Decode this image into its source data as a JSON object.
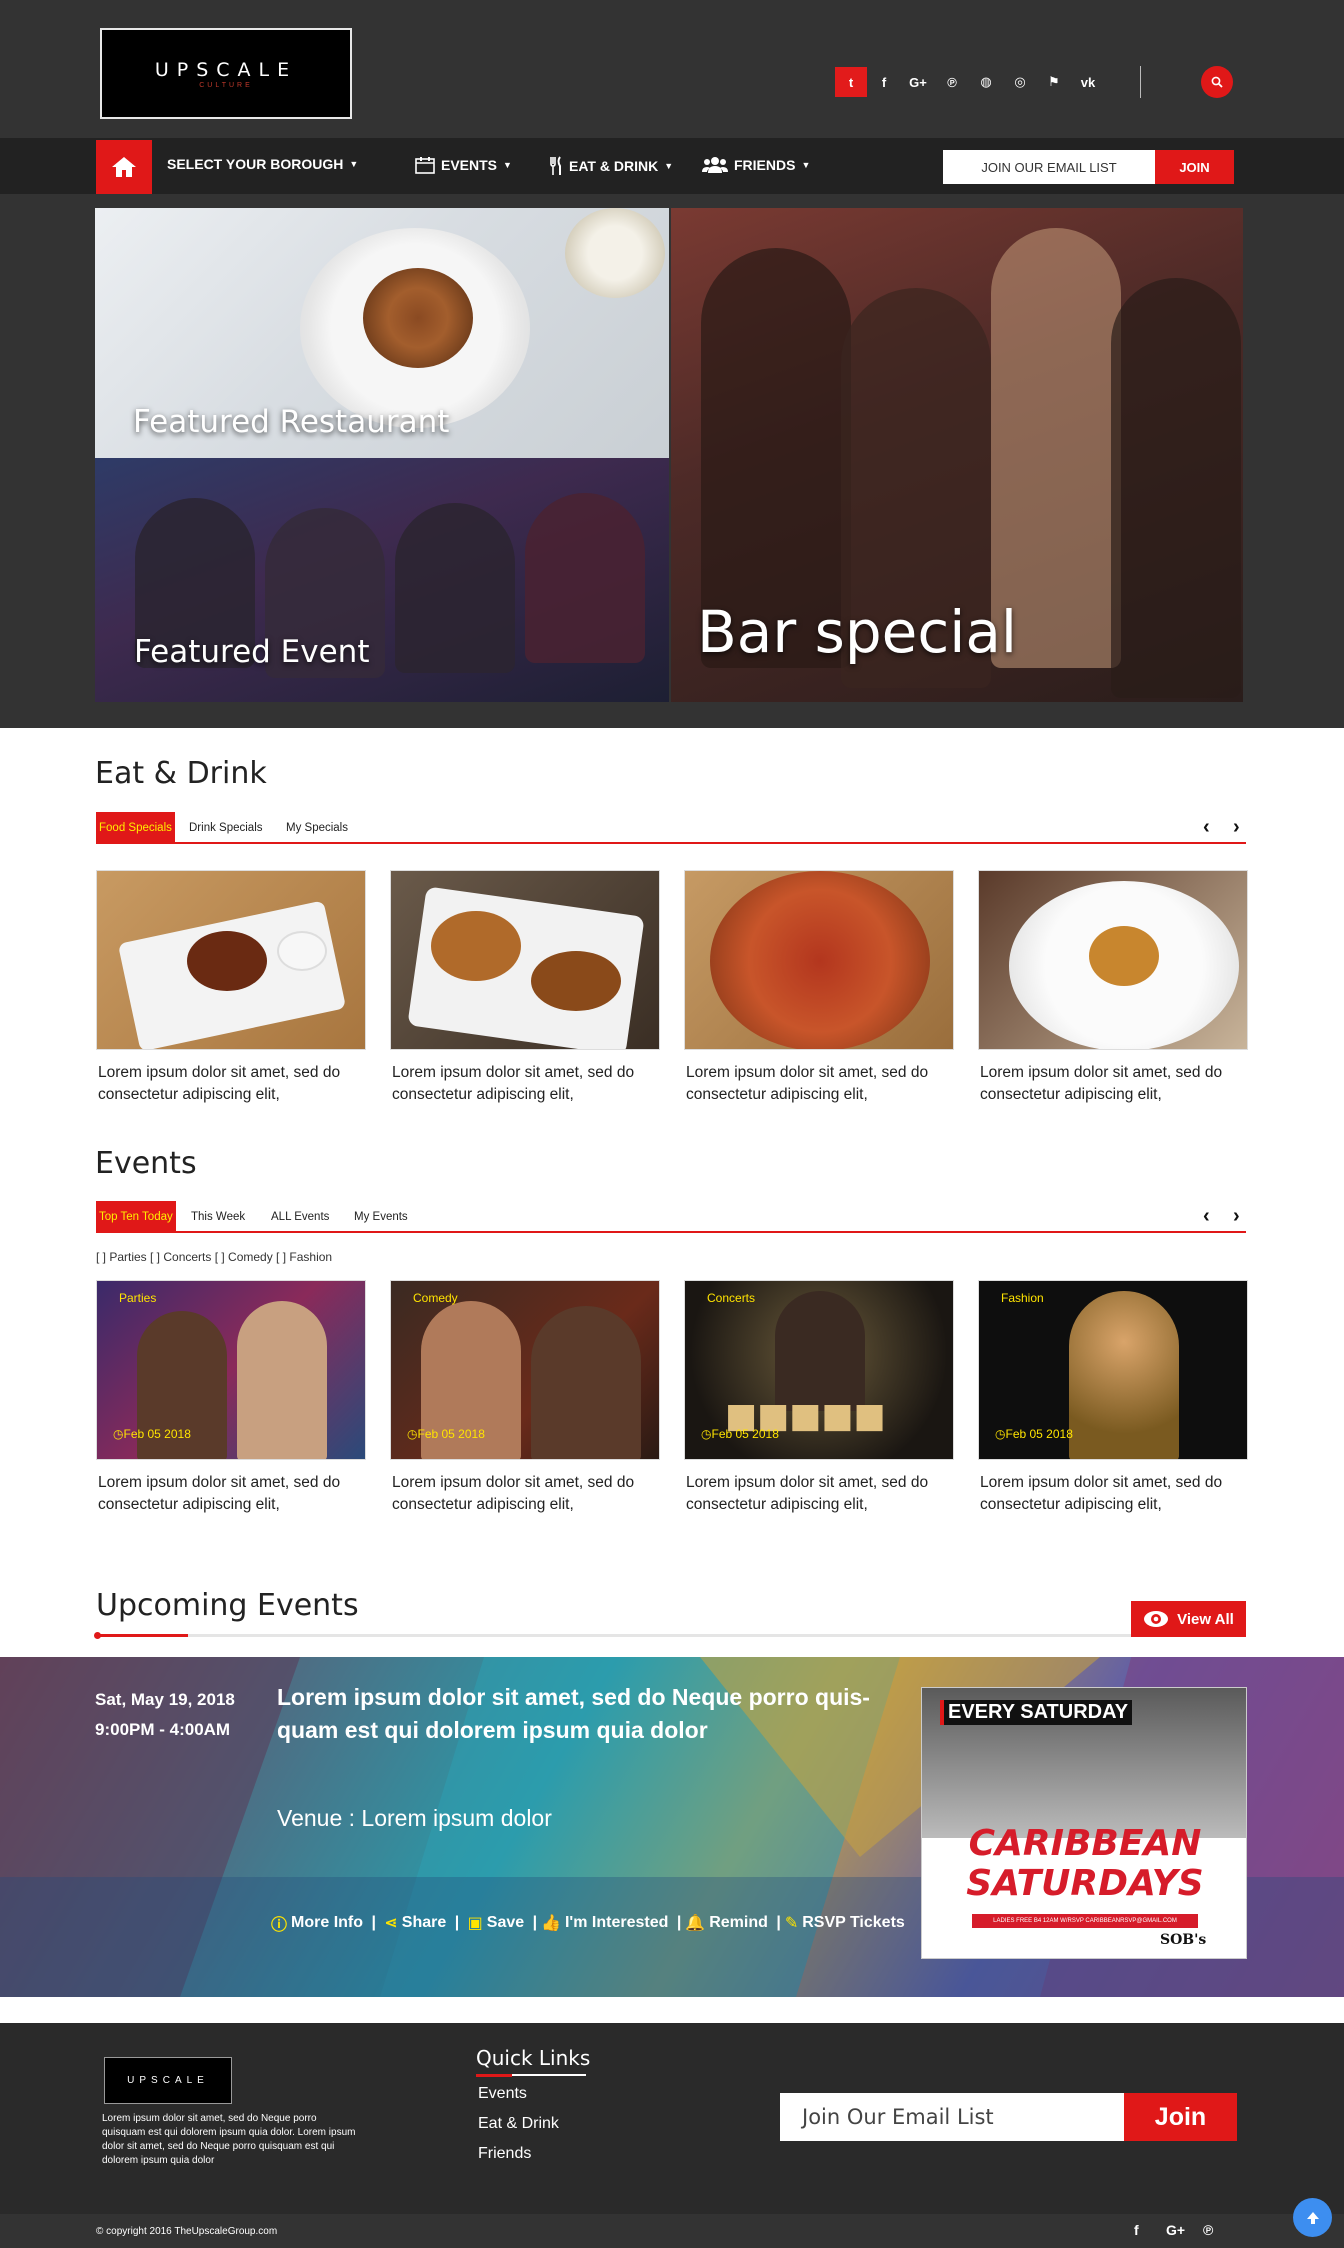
{
  "brand": {
    "logo_text": "UPSCALE",
    "logo_sub": "CULTURE",
    "footer_logo_text": "UPSCALE"
  },
  "header": {
    "social_icons": [
      "twitter-icon",
      "facebook-icon",
      "google-plus-icon",
      "pinterest-icon",
      "github-icon",
      "dribbble-icon",
      "foursquare-icon",
      "vk-icon"
    ],
    "social_glyphs": [
      "t",
      "f",
      "G+",
      "℗",
      "◍",
      "◎",
      "⚑",
      "vk"
    ],
    "search_icon": "search-icon"
  },
  "nav": {
    "borough_label": "SELECT YOUR BOROUGH",
    "events_label": "EVENTS",
    "eat_drink_label": "EAT & DRINK",
    "friends_label": "FRIENDS",
    "email_label": "JOIN OUR EMAIL LIST",
    "join_label": "JOIN"
  },
  "hero": {
    "featured_restaurant": "Featured Restaurant",
    "featured_event": "Featured Event",
    "bar_special": "Bar special"
  },
  "eat_drink": {
    "title": "Eat & Drink",
    "tabs": [
      "Food Specials",
      "Drink Specials",
      "My Specials"
    ],
    "cards": [
      {
        "text": "Lorem ipsum dolor sit amet, sed do consectetur adipiscing elit,"
      },
      {
        "text": "Lorem ipsum dolor sit amet, sed do consectetur adipiscing elit,"
      },
      {
        "text": "Lorem ipsum dolor sit amet, sed do consectetur adipiscing elit,"
      },
      {
        "text": "Lorem ipsum dolor sit amet, sed do consectetur adipiscing elit,"
      }
    ]
  },
  "events": {
    "title": "Events",
    "tabs": [
      "Top Ten Today",
      "This Week",
      "ALL Events",
      "My Events"
    ],
    "filters": "[ ] Parties   [ ] Concerts  [ ] Comedy  [ ] Fashion",
    "cards": [
      {
        "category": "Parties",
        "date": "Feb 05 2018",
        "text": "Lorem ipsum dolor sit amet, sed do consectetur adipiscing elit,"
      },
      {
        "category": "Comedy",
        "date": "Feb 05 2018",
        "text": "Lorem ipsum dolor sit amet, sed do consectetur adipiscing elit,"
      },
      {
        "category": "Concerts",
        "date": "Feb 05 2018",
        "text": "Lorem ipsum dolor sit amet, sed do consectetur adipiscing elit,"
      },
      {
        "category": "Fashion",
        "date": "Feb 05 2018",
        "text": "Lorem ipsum dolor sit amet, sed do consectetur adipiscing elit,"
      }
    ]
  },
  "upcoming": {
    "title": "Upcoming Events",
    "view_all": "View All",
    "date": "Sat, May 19, 2018",
    "time": "9:00PM - 4:00AM",
    "headline": "Lorem ipsum dolor sit amet, sed do Neque porro quis-quam est qui dolorem ipsum quia dolor",
    "venue": "Venue : Lorem ipsum dolor",
    "actions": [
      "More Info",
      "Share",
      "Save",
      "I'm Interested",
      "Remind",
      "RSVP Tickets"
    ],
    "flyer_top": "EVERY SATURDAY",
    "flyer_title_1": "CARIBBEAN",
    "flyer_title_2": "SATURDAYS",
    "flyer_strip": "LADIES FREE B4 12AM W/RSVP CARIBBEANRSVP@GMAIL.COM",
    "flyer_brand": "SOB's"
  },
  "footer": {
    "description": "Lorem ipsum dolor sit amet, sed do Neque porro quisquam est qui dolorem ipsum quia dolor. Lorem ipsum dolor sit amet, sed do Neque porro quisquam est qui dolorem ipsum quia dolor",
    "quick_links_title": "Quick Links",
    "links": [
      "Events",
      "Eat & Drink",
      "Friends"
    ],
    "email_placeholder": "Join Our Email List",
    "join_label": "Join",
    "copyright": "© copyright 2016 TheUpscaleGroup.com"
  },
  "colors": {
    "accent": "#e01818",
    "header_bg": "#333333",
    "nav_bg": "#222222",
    "highlight": "#ffee00"
  }
}
